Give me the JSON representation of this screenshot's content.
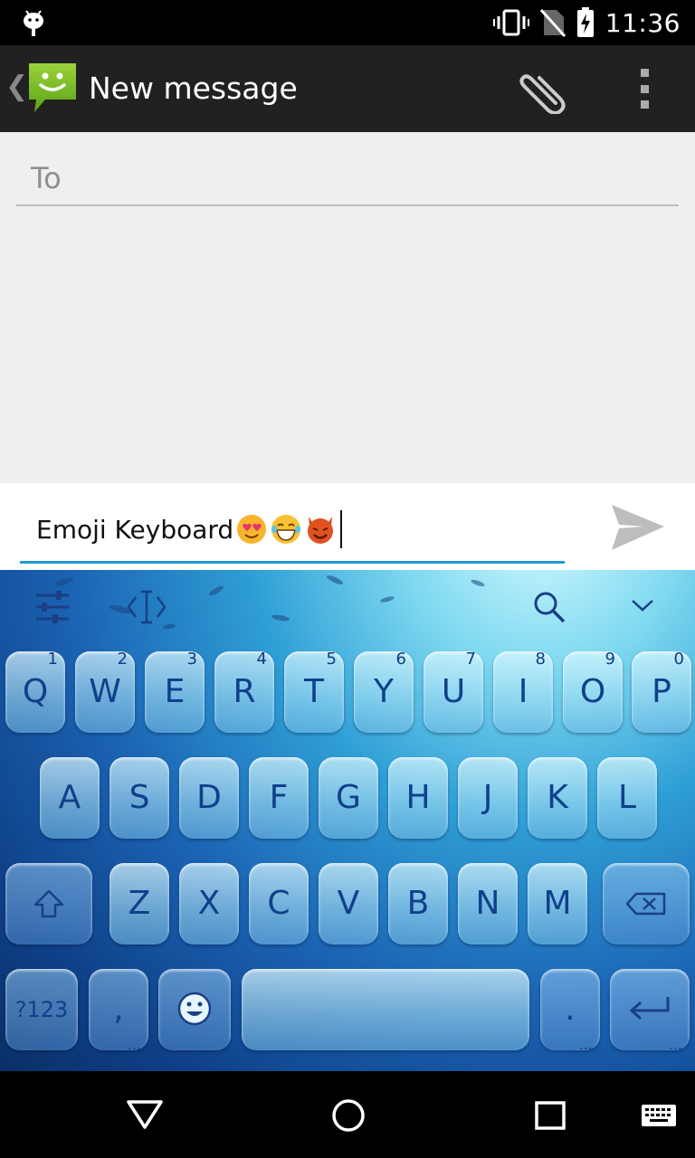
{
  "status_bar": {
    "time": "11:36"
  },
  "app_bar": {
    "title": "New message"
  },
  "recipient": {
    "placeholder": "To"
  },
  "compose": {
    "text": "Emoji Keyboard"
  },
  "keyboard": {
    "row1": [
      {
        "label": "Q",
        "hint": "1"
      },
      {
        "label": "W",
        "hint": "2"
      },
      {
        "label": "E",
        "hint": "3"
      },
      {
        "label": "R",
        "hint": "4"
      },
      {
        "label": "T",
        "hint": "5"
      },
      {
        "label": "Y",
        "hint": "6"
      },
      {
        "label": "U",
        "hint": "7"
      },
      {
        "label": "I",
        "hint": "8"
      },
      {
        "label": "O",
        "hint": "9"
      },
      {
        "label": "P",
        "hint": "0"
      }
    ],
    "row2": [
      "A",
      "S",
      "D",
      "F",
      "G",
      "H",
      "J",
      "K",
      "L"
    ],
    "row3": [
      "Z",
      "X",
      "C",
      "V",
      "B",
      "N",
      "M"
    ],
    "symbols_label": "?123",
    "comma_label": ",",
    "period_label": "."
  },
  "colors": {
    "accent": "#1e9bd4",
    "app_bar": "#212121",
    "key_text": "#10408a"
  }
}
